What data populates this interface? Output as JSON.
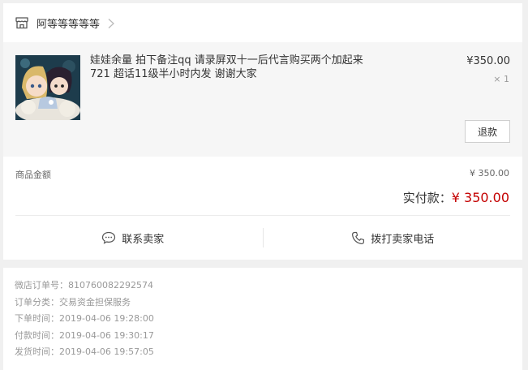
{
  "shop": {
    "name": "阿等等等等等"
  },
  "product": {
    "title": "娃娃余量 拍下备注qq 请录屏双十一后代言购买两个加起来721 超话11级半小时内发 谢谢大家",
    "price": "¥350.00",
    "quantity": "× 1",
    "refund_label": "退款"
  },
  "amount": {
    "goods_label": "商品金额",
    "goods_value": "¥ 350.00",
    "paid_label": "实付款：",
    "paid_value": "¥ 350.00"
  },
  "actions": {
    "contact_label": "联系卖家",
    "call_label": "拨打卖家电话"
  },
  "order_info": [
    {
      "label": "微店订单号：",
      "value": "810760082292574"
    },
    {
      "label": "订单分类：",
      "value": "交易资金担保服务"
    },
    {
      "label": "下单时间：",
      "value": "2019-04-06 19:28:00"
    },
    {
      "label": "付款时间：",
      "value": "2019-04-06 19:30:17"
    },
    {
      "label": "发货时间：",
      "value": "2019-04-06 19:57:05"
    }
  ],
  "icons": {
    "shop": "shop-icon",
    "chevron": "chevron-right-icon",
    "chat": "chat-bubble-icon",
    "phone": "phone-icon"
  },
  "colors": {
    "accent": "#c40000",
    "background": "#f0f0f0"
  }
}
